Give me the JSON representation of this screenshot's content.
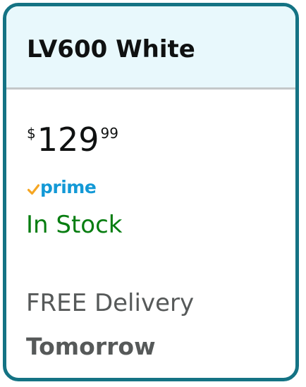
{
  "product": {
    "title": "LV600 White"
  },
  "price": {
    "symbol": "$",
    "whole": "129",
    "fraction": "99"
  },
  "prime": {
    "label": "prime",
    "check_icon": "prime-check-icon",
    "colors": {
      "check": "#f5a623",
      "text": "#1399d6"
    }
  },
  "availability": {
    "status": "In Stock",
    "color": "#067d10"
  },
  "delivery": {
    "label": "FREE Delivery",
    "date": "Tomorrow"
  },
  "colors": {
    "border": "#147384",
    "header_bg": "#e8f8fc",
    "text": "#0f1111",
    "muted": "#565959"
  }
}
